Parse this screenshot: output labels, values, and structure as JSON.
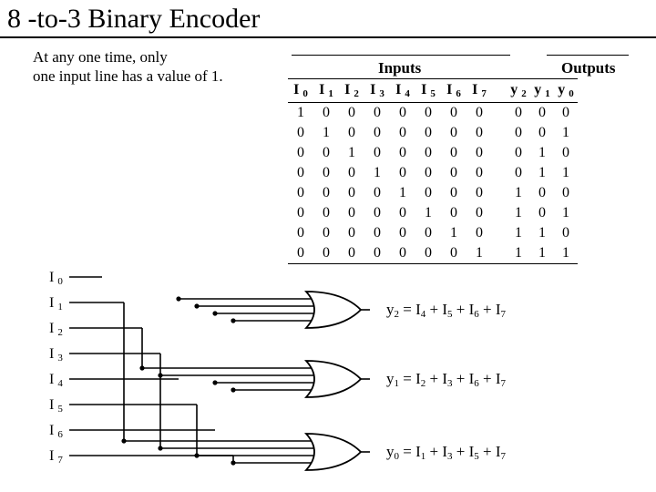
{
  "title": "8 -to-3  Binary Encoder",
  "subtitle_line1": "At any one time, only",
  "subtitle_line2": "one input line has a value of  1.",
  "io": {
    "inputs_label": "Inputs",
    "outputs_label": "Outputs"
  },
  "table": {
    "input_headers": [
      "I 0",
      "I 1",
      "I 2",
      "I 3",
      "I 4",
      "I 5",
      "I 6",
      "I 7"
    ],
    "output_headers": [
      "y2",
      "y1",
      "y0"
    ],
    "rows": [
      {
        "in": [
          "1",
          "0",
          "0",
          "0",
          "0",
          "0",
          "0",
          "0"
        ],
        "out": [
          "0",
          "0",
          "0"
        ]
      },
      {
        "in": [
          "0",
          "1",
          "0",
          "0",
          "0",
          "0",
          "0",
          "0"
        ],
        "out": [
          "0",
          "0",
          "1"
        ]
      },
      {
        "in": [
          "0",
          "0",
          "1",
          "0",
          "0",
          "0",
          "0",
          "0"
        ],
        "out": [
          "0",
          "1",
          "0"
        ]
      },
      {
        "in": [
          "0",
          "0",
          "0",
          "1",
          "0",
          "0",
          "0",
          "0"
        ],
        "out": [
          "0",
          "1",
          "1"
        ]
      },
      {
        "in": [
          "0",
          "0",
          "0",
          "0",
          "1",
          "0",
          "0",
          "0"
        ],
        "out": [
          "1",
          "0",
          "0"
        ]
      },
      {
        "in": [
          "0",
          "0",
          "0",
          "0",
          "0",
          "1",
          "0",
          "0"
        ],
        "out": [
          "1",
          "0",
          "1"
        ]
      },
      {
        "in": [
          "0",
          "0",
          "0",
          "0",
          "0",
          "0",
          "1",
          "0"
        ],
        "out": [
          "1",
          "1",
          "0"
        ]
      },
      {
        "in": [
          "0",
          "0",
          "0",
          "0",
          "0",
          "0",
          "0",
          "1"
        ],
        "out": [
          "1",
          "1",
          "1"
        ]
      }
    ]
  },
  "pins": [
    "I0",
    "I1",
    "I2",
    "I3",
    "I4",
    "I5",
    "I6",
    "I7"
  ],
  "equations": {
    "y2": "y2 = I4 + I5 + I6 + I7",
    "y1": "y1 = I2 + I3 + I6 + I7",
    "y0": "y0 = I1 + I3 + I5 + I7"
  },
  "chart_data": {
    "type": "table",
    "title": "8-to-3 Binary Encoder truth table",
    "columns": [
      "I0",
      "I1",
      "I2",
      "I3",
      "I4",
      "I5",
      "I6",
      "I7",
      "y2",
      "y1",
      "y0"
    ],
    "rows": [
      [
        1,
        0,
        0,
        0,
        0,
        0,
        0,
        0,
        0,
        0,
        0
      ],
      [
        0,
        1,
        0,
        0,
        0,
        0,
        0,
        0,
        0,
        0,
        1
      ],
      [
        0,
        0,
        1,
        0,
        0,
        0,
        0,
        0,
        0,
        1,
        0
      ],
      [
        0,
        0,
        0,
        1,
        0,
        0,
        0,
        0,
        0,
        1,
        1
      ],
      [
        0,
        0,
        0,
        0,
        1,
        0,
        0,
        0,
        1,
        0,
        0
      ],
      [
        0,
        0,
        0,
        0,
        0,
        1,
        0,
        0,
        1,
        0,
        1
      ],
      [
        0,
        0,
        0,
        0,
        0,
        0,
        1,
        0,
        1,
        1,
        0
      ],
      [
        0,
        0,
        0,
        0,
        0,
        0,
        0,
        1,
        1,
        1,
        1
      ]
    ]
  }
}
